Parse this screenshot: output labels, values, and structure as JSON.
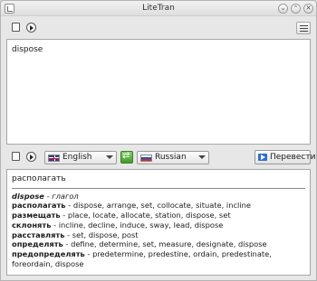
{
  "window": {
    "title": "LiteTran",
    "controls": {
      "minimize": "⌄",
      "maximize": "⌃",
      "close": "✕"
    }
  },
  "source": {
    "text": "dispose"
  },
  "languages": {
    "from": "English",
    "to": "Russian"
  },
  "translate_button": "Перевести",
  "result": {
    "headline": "располагать",
    "word": "dispose",
    "pos_sep": " - ",
    "pos": "глагол",
    "entries": [
      {
        "term": "располагать",
        "synonyms": " - dispose, arrange, set, collocate, situate, incline"
      },
      {
        "term": "размещать",
        "synonyms": " - place, locate, allocate, station, dispose, set"
      },
      {
        "term": "склонять",
        "synonyms": " - incline, decline, induce, sway, lead, dispose"
      },
      {
        "term": "расставлять",
        "synonyms": " - set, dispose, post"
      },
      {
        "term": "определять",
        "synonyms": " - define, determine, set, measure, designate, dispose"
      },
      {
        "term": "предопределять",
        "synonyms": " - predetermine, predestine, ordain, predestinate, foreordain, dispose"
      }
    ]
  }
}
